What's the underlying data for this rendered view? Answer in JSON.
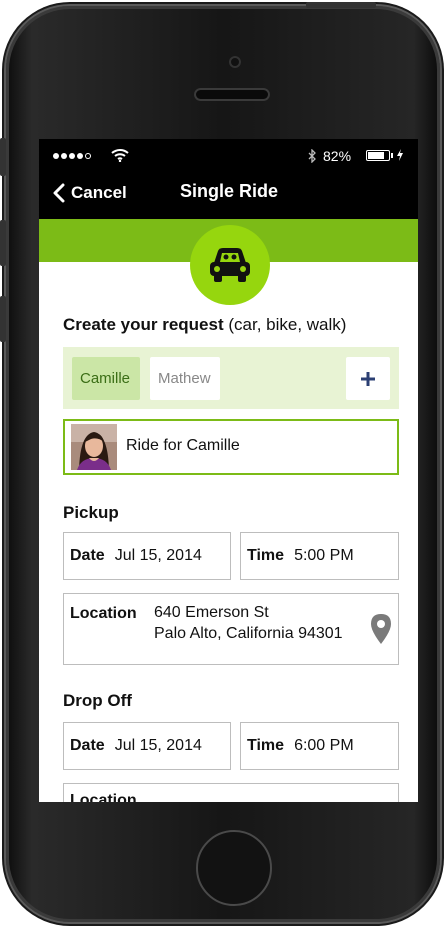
{
  "status": {
    "battery_percent": "82%",
    "battery_level": 0.82
  },
  "nav": {
    "back_label": "Cancel",
    "title": "Single Ride"
  },
  "icons": {
    "back": "chevron-left-icon",
    "car": "car-icon",
    "add": "plus-icon",
    "pin": "location-pin-icon"
  },
  "colors": {
    "accent_green": "#7cbb17",
    "chip_selected": "#cbe6a6",
    "rider_bar_bg": "#e8f3d4",
    "plus_blue": "#2b3f73"
  },
  "request": {
    "title": "Create your request",
    "hint": "(car, bike, walk)"
  },
  "riders": [
    {
      "name": "Camille",
      "selected": true
    },
    {
      "name": "Mathew",
      "selected": false
    }
  ],
  "ride_for": "Ride for Camille",
  "pickup": {
    "section": "Pickup",
    "date_label": "Date",
    "date_value": "Jul 15, 2014",
    "time_label": "Time",
    "time_value": "5:00 PM",
    "location_label": "Location",
    "location_line1": "640 Emerson St",
    "location_line2": "Palo Alto, California 94301"
  },
  "dropoff": {
    "section": "Drop Off",
    "date_label": "Date",
    "date_value": "Jul 15, 2014",
    "time_label": "Time",
    "time_value": "6:00 PM",
    "location_label": "Location"
  }
}
